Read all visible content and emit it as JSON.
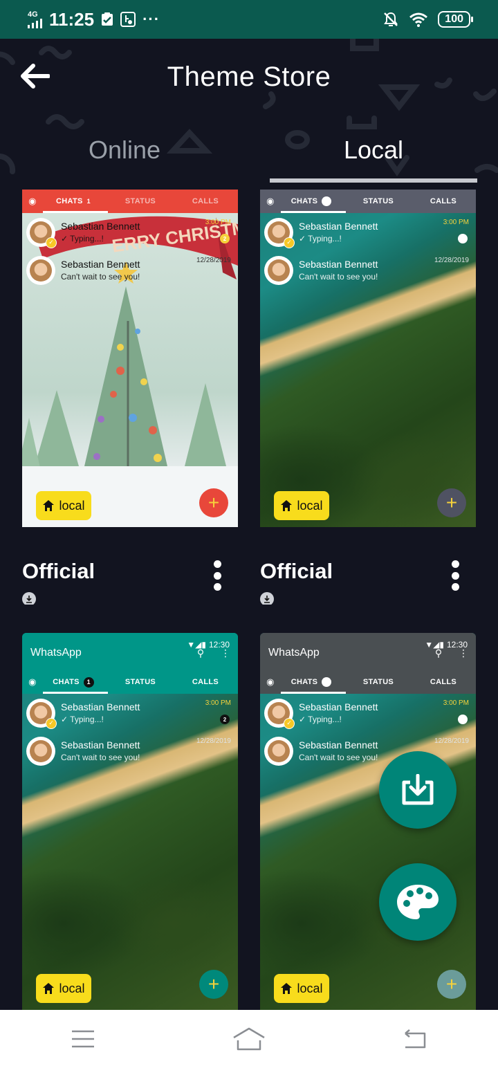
{
  "status_bar": {
    "network": "4G",
    "time": "11:25",
    "more": "···",
    "battery": "100"
  },
  "header": {
    "title": "Theme Store",
    "back_icon": "arrow-left-icon"
  },
  "tabs": [
    {
      "label": "Online",
      "active": false
    },
    {
      "label": "Local",
      "active": true
    }
  ],
  "themes": [
    {
      "name": "Official",
      "tabs": {
        "chats": "CHATS",
        "status": "STATUS",
        "calls": "CALLS",
        "chats_count": "1"
      },
      "chats": [
        {
          "name": "Sebastian Bennett",
          "message": "Typing...!",
          "time": "3:00 PM",
          "badge": "2"
        },
        {
          "name": "Sebastian Bennett",
          "message": "Can't wait to see you!",
          "time": "12/28/2019"
        }
      ],
      "local_label": "local",
      "banner": "ERRY CHRISTMA",
      "accent": "#e8473a"
    },
    {
      "name": "Official",
      "tabs": {
        "chats": "CHATS",
        "status": "STATUS",
        "calls": "CALLS"
      },
      "chats": [
        {
          "name": "Sebastian Bennett",
          "message": "Typing...!",
          "time": "3:00 PM"
        },
        {
          "name": "Sebastian Bennett",
          "message": "Can't wait to see you!",
          "time": "12/28/2019"
        }
      ],
      "local_label": "local",
      "accent": "#5a5d6b"
    },
    {
      "app_title": "WhatsApp",
      "clock": "12:30",
      "tabs": {
        "chats": "CHATS",
        "status": "STATUS",
        "calls": "CALLS",
        "chats_count": "1"
      },
      "chats": [
        {
          "name": "Sebastian Bennett",
          "message": "Typing...!",
          "time": "3:00 PM",
          "badge": "2"
        },
        {
          "name": "Sebastian Bennett",
          "message": "Can't wait to see you!",
          "time": "12/28/2019"
        }
      ],
      "local_label": "local",
      "accent": "#009688"
    },
    {
      "app_title": "WhatsApp",
      "clock": "12:30",
      "tabs": {
        "chats": "CHATS",
        "status": "STATUS",
        "calls": "CALLS"
      },
      "chats": [
        {
          "name": "Sebastian Bennett",
          "message": "Typing...!",
          "time": "3:00 PM"
        },
        {
          "name": "Sebastian Bennett",
          "message": "Can't wait to see you!",
          "time": "12/28/2019"
        }
      ],
      "local_label": "local",
      "accent": "#4a4f52"
    }
  ],
  "fabs": {
    "import_icon": "import-icon",
    "palette_icon": "palette-icon",
    "color": "#008578"
  },
  "navbar": {
    "menu_icon": "menu-icon",
    "home_icon": "home-icon",
    "back_icon": "back-icon"
  }
}
